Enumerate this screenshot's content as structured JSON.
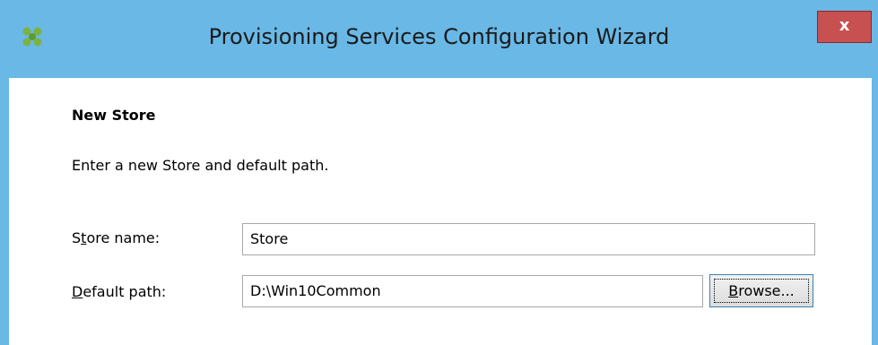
{
  "window": {
    "title": "Provisioning Services Configuration Wizard",
    "close_label": "x",
    "app_icon": "citrix-flower-icon"
  },
  "page": {
    "heading": "New Store",
    "description": "Enter a new Store and default path."
  },
  "fields": {
    "store_name": {
      "label_pre": "S",
      "label_mnemonic": "t",
      "label_post": "ore name:",
      "value": "Store"
    },
    "default_path": {
      "label_pre": "",
      "label_mnemonic": "D",
      "label_post": "efault path:",
      "value": "D:\\Win10Common"
    }
  },
  "buttons": {
    "browse_mnemonic": "B",
    "browse_rest": "rowse..."
  },
  "colors": {
    "titlebar": "#69b8e6",
    "close": "#c75050"
  }
}
